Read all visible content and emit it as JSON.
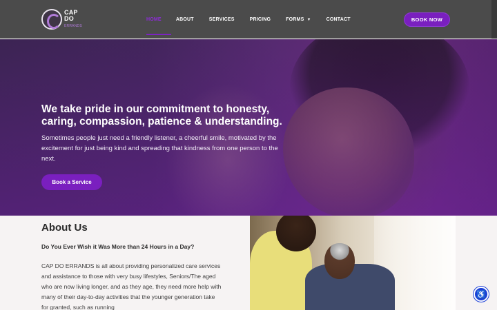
{
  "brand": {
    "name": "CAP DO",
    "tagline": "ERRANDS"
  },
  "nav": {
    "items": [
      {
        "label": "HOME",
        "active": true
      },
      {
        "label": "ABOUT",
        "active": false
      },
      {
        "label": "SERVICES",
        "active": false
      },
      {
        "label": "PRICING",
        "active": false
      },
      {
        "label": "FORMS",
        "active": false,
        "has_dropdown": true
      },
      {
        "label": "CONTACT",
        "active": false
      }
    ],
    "cta_label": "BOOK NOW"
  },
  "hero": {
    "title": "We take pride in our commitment to honesty, caring, compassion, patience & understanding.",
    "text": "Sometimes people just need a friendly listener, a cheerful smile, motivated by the excitement for just being kind and spreading that kindness from one person to the next.",
    "button_label": "Book a Service"
  },
  "about": {
    "title": "About Us",
    "subtitle": "Do You Ever Wish it Was More than 24 Hours in a Day?",
    "text": "CAP DO ERRANDS is all about providing personalized care services and assistance to those with very busy lifestyles, Seniors/The aged who are now living longer, and as they age, they need more help with many of their day-to-day activities that the younger generation take for granted, such as running"
  },
  "colors": {
    "accent": "#7a1fbf",
    "header_bg": "#4b4b4b",
    "a11y": "#1b3fd6"
  },
  "icons": {
    "dropdown": "chevron-down-icon",
    "accessibility": "accessibility-icon"
  }
}
